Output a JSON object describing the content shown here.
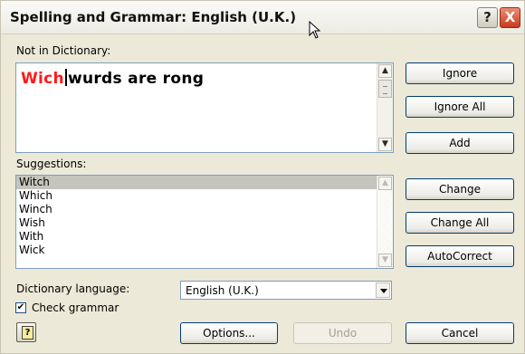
{
  "window": {
    "title": "Spelling and Grammar: English (U.K.)",
    "help_label": "?",
    "close_label": "X"
  },
  "not_in_dictionary": {
    "label": "Not in Dictionary:",
    "flagged_word": "Wich",
    "rest_text": "wurds are rong"
  },
  "suggestions": {
    "label": "Suggestions:",
    "items": [
      "Witch",
      "Which",
      "Winch",
      "Wish",
      "With",
      "Wick"
    ],
    "selected_index": 0
  },
  "buttons": {
    "ignore": "Ignore",
    "ignore_all": "Ignore All",
    "add": "Add",
    "change": "Change",
    "change_all": "Change All",
    "autocorrect": "AutoCorrect",
    "options": "Options...",
    "undo": "Undo",
    "cancel": "Cancel"
  },
  "dictionary_language": {
    "label": "Dictionary language:",
    "value": "English (U.K.)"
  },
  "check_grammar": {
    "label": "Check grammar",
    "checked": true,
    "mark": "✔"
  },
  "colors": {
    "flagged_word": "#ff1a1a",
    "dialog_bg": "#ece9d8",
    "selection": "#c5c4bd"
  }
}
